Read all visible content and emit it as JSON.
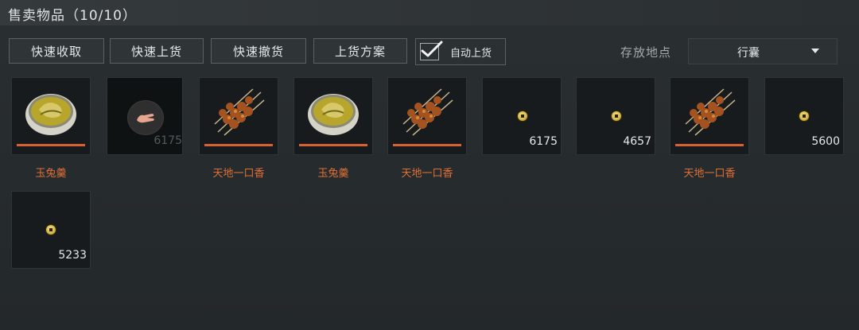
{
  "header": {
    "title": "售卖物品（10/10）"
  },
  "toolbar": {
    "quick_collect": "快速收取",
    "quick_list": "快速上货",
    "quick_withdraw": "快速撤货",
    "listing_plan": "上货方案",
    "auto_list": {
      "label": "自动上货",
      "checked": true
    },
    "storage_label": "存放地点",
    "storage_value": "行囊"
  },
  "slots": [
    {
      "type": "item",
      "icon": "soup-bowl-icon",
      "name": "玉兔羹",
      "amount": ""
    },
    {
      "type": "item",
      "icon": "hand-icon",
      "name": "",
      "amount": "6175"
    },
    {
      "type": "item",
      "icon": "skewer-icon",
      "name": "天地一口香",
      "amount": ""
    },
    {
      "type": "item",
      "icon": "soup-bowl-icon",
      "name": "玉兔羹",
      "amount": ""
    },
    {
      "type": "item",
      "icon": "skewer-icon",
      "name": "天地一口香",
      "amount": ""
    },
    {
      "type": "coin",
      "icon": "coin-icon",
      "name": "",
      "amount": "6175"
    },
    {
      "type": "coin",
      "icon": "coin-icon",
      "name": "",
      "amount": "4657"
    },
    {
      "type": "item",
      "icon": "skewer-icon",
      "name": "天地一口香",
      "amount": ""
    },
    {
      "type": "coin",
      "icon": "coin-icon",
      "name": "",
      "amount": "5600"
    },
    {
      "type": "coin",
      "icon": "coin-icon",
      "name": "",
      "amount": "5233"
    }
  ],
  "colors": {
    "accent": "#d9602f",
    "item_name": "#e06f36",
    "background": "#272c2e"
  }
}
